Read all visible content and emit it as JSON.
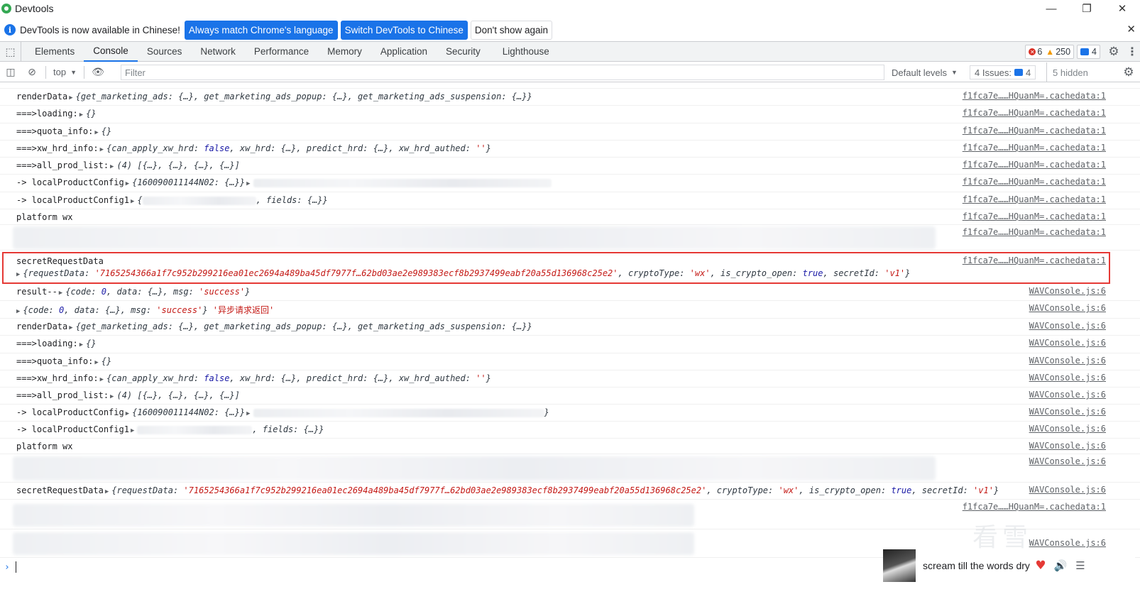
{
  "window": {
    "title": "Devtools",
    "minimize": "—",
    "restore": "❐",
    "close": "✕"
  },
  "infobar": {
    "text": "DevTools is now available in Chinese!",
    "btn_match": "Always match Chrome's language",
    "btn_switch": "Switch DevTools to Chinese",
    "btn_dismiss": "Don't show again",
    "close": "✕"
  },
  "tabs": [
    "Elements",
    "Console",
    "Sources",
    "Network",
    "Performance",
    "Memory",
    "Application",
    "Security",
    "Lighthouse"
  ],
  "active_tab": "Console",
  "counters": {
    "errors": "6",
    "warnings": "250",
    "messages": "4"
  },
  "toolbar": {
    "context": "top",
    "filter_placeholder": "Filter",
    "levels": "Default levels",
    "issues_label": "4 Issues:",
    "issues_count": "4",
    "hidden": "5 hidden"
  },
  "sources": {
    "cached": "f1fca7e……HQuanM=.cachedata:1",
    "wav": "WAVConsole.js:6"
  },
  "rows": {
    "render_label": "renderData",
    "render_obj": "{get_marketing_ads: {…}, get_marketing_ads_popup: {…}, get_marketing_ads_suspension: {…}}",
    "loading_label": "===>loading:",
    "loading_obj": "{}",
    "quota_label": "===>quota_info:",
    "quota_obj": "{}",
    "xw_label": "===>xw_hrd_info:",
    "xw_open": "{can_apply_xw_hrd: ",
    "xw_false": "false",
    "xw_mid": ", xw_hrd: {…}, predict_hrd: {…}, xw_hrd_authed: ",
    "xw_empty": "''",
    "xw_close": "}",
    "prod_label": "===>all_prod_list:",
    "prod_obj": "(4) [{…}, {…}, {…}, {…}]",
    "lpc_label": "-> localProductConfig",
    "lpc_obj": "{160090011144N02: {…}}",
    "lpc1_label": "-> localProductConfig1",
    "lpc1_open": "{",
    "lpc1_tail": ", fields: {…}}",
    "platform": "platform wx",
    "secret_label": "secretRequestData",
    "secret_open": "{requestData: ",
    "secret_hash": "'7165254366a1f7c952b299216ea01ec2694a489ba45df7977f…62bd03ae2e989383ecf8b2937499eabf20a55d136968c25e2'",
    "secret_mid1": ", cryptoType: ",
    "secret_wx": "'wx'",
    "secret_mid2": ", is_crypto_open: ",
    "secret_true": "true",
    "secret_mid3": ", secretId: ",
    "secret_v1": "'v1'",
    "secret_close": "}",
    "result_label": "result--",
    "result_open": "{code: ",
    "result_zero": "0",
    "result_mid": ", data: {…}, msg: ",
    "result_success": "'success'",
    "result_close": "}",
    "async_note": "'异步请求返回'",
    "lpc2_tail": "}"
  },
  "music": {
    "song": "scream till the words dry",
    "heart": "♥",
    "volume": "🔊",
    "list": "☰"
  },
  "watermark": "看雪",
  "colors": {
    "accent": "#1a73e8",
    "highlight": "#e53935",
    "string": "#c41a16",
    "keyword": "#1a1aa6"
  }
}
